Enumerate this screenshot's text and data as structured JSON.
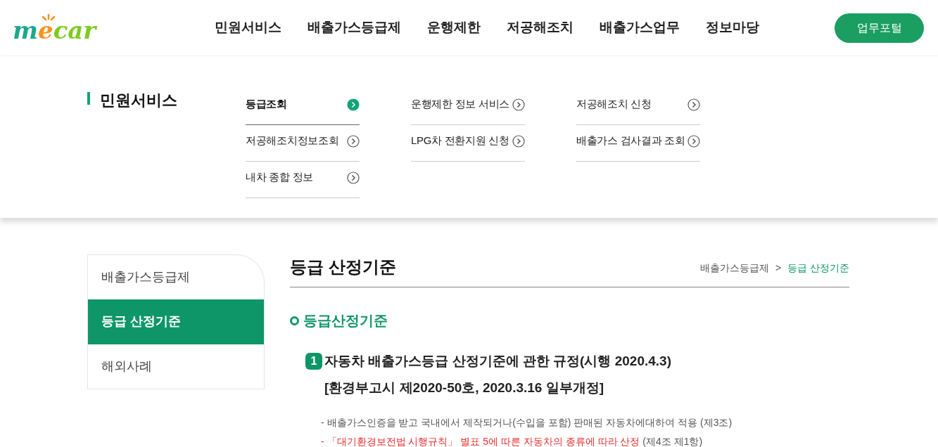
{
  "logo": {
    "letters": [
      {
        "text": "m",
        "color": "#1ba88c"
      },
      {
        "text": "e",
        "color": "#f7931e"
      },
      {
        "text": "car",
        "color": "#7ecb20"
      }
    ]
  },
  "nav": [
    {
      "label": "민원서비스"
    },
    {
      "label": "배출가스등급제"
    },
    {
      "label": "운행제한"
    },
    {
      "label": "저공해조치"
    },
    {
      "label": "배출가스업무"
    },
    {
      "label": "정보마당"
    }
  ],
  "portal_button": "업무포털",
  "mega_menu": {
    "title": "민원서비스",
    "columns": [
      [
        {
          "label": "등급조회",
          "selected": true
        },
        {
          "label": "저공해조치정보조회",
          "selected": false
        },
        {
          "label": "내차 종합 정보",
          "selected": false
        }
      ],
      [
        {
          "label": "운행제한 정보 서비스",
          "selected": false
        },
        {
          "label": "LPG차 전환지원 신청",
          "selected": false
        }
      ],
      [
        {
          "label": "저공해조치 신청",
          "selected": false
        },
        {
          "label": "배출가스 검사결과 조회",
          "selected": false
        }
      ]
    ]
  },
  "sidebar": {
    "items": [
      {
        "label": "배출가스등급제",
        "selected": false
      },
      {
        "label": "등급 산정기준",
        "selected": true
      },
      {
        "label": "해외사례",
        "selected": false
      }
    ]
  },
  "page": {
    "title": "등급 산정기준",
    "breadcrumb": [
      "배출가스등급제",
      ">",
      "등급 산정기준"
    ],
    "section_title": "등급산정기준",
    "rule": {
      "number": "1",
      "lines": [
        "자동차 배출가스등급 산정기준에 관한 규정(시행 2020.4.3)",
        "[환경부고시 제2020-50호, 2020.3.16 일부개정]"
      ]
    },
    "bullets": [
      [
        {
          "text": "- 배출가스인증을 받고 국내에서 제작되거나(수입을 포함) 판매된 자동차에대하여 적용 (제3조)",
          "highlight": false
        }
      ],
      [
        {
          "text": "- 「대기환경보전법 시행규칙」 별표 5에 따른 자동차의 종류에 따라 산정",
          "highlight": true
        },
        {
          "text": " (제4조 제1항)",
          "highlight": false
        }
      ]
    ]
  }
}
